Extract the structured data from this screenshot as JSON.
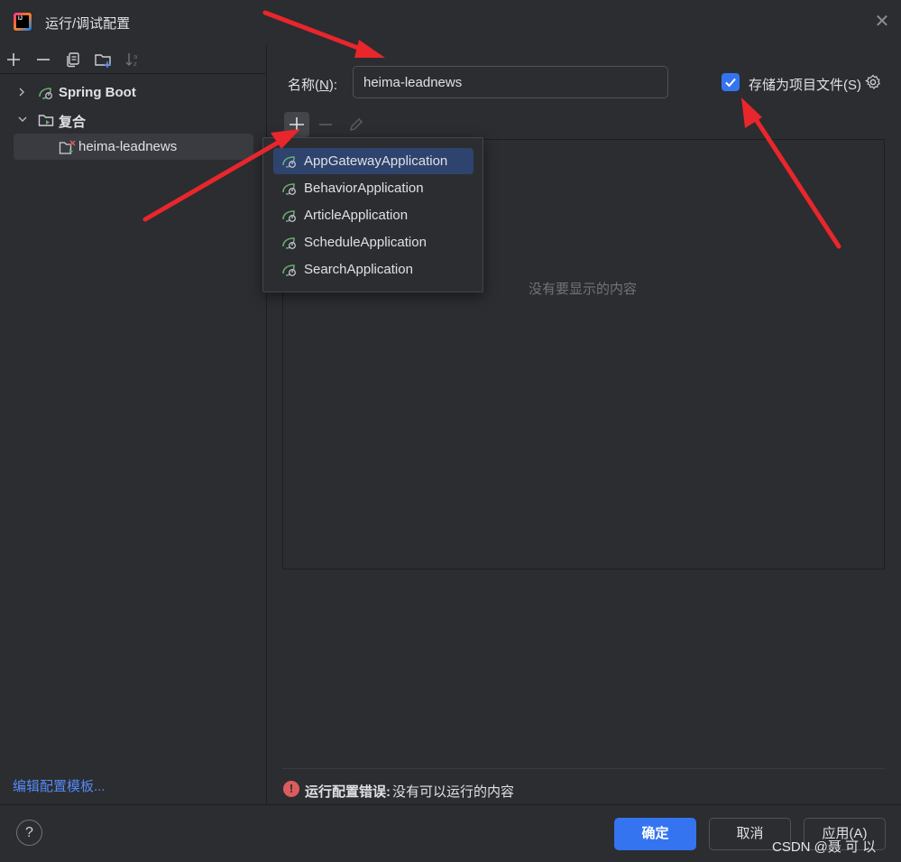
{
  "window": {
    "title": "运行/调试配置",
    "app_logo_text": "IJ"
  },
  "left_toolbar": {
    "icons": [
      "add-icon",
      "remove-icon",
      "copy-icon",
      "folder-add-icon",
      "sort-icon"
    ]
  },
  "tree": {
    "items": [
      {
        "label": "Spring Boot",
        "expanded": false,
        "icon": "spring-boot-icon"
      },
      {
        "label": "复合",
        "expanded": true,
        "icon": "folder-icon"
      },
      {
        "label": "heima-leadnews",
        "selected": true,
        "icon": "compound-config-icon"
      }
    ],
    "edit_templates_link": "编辑配置模板..."
  },
  "form": {
    "name_label": "名称(N):",
    "name_value": "heima-leadnews",
    "store_as_project_file_label": "存储为项目文件(S)",
    "store_as_project_file_checked": true
  },
  "list": {
    "empty_text": "没有要显示的内容"
  },
  "popup": {
    "items": [
      {
        "label": "AppGatewayApplication",
        "selected": true
      },
      {
        "label": "BehaviorApplication",
        "selected": false
      },
      {
        "label": "ArticleApplication",
        "selected": false
      },
      {
        "label": "ScheduleApplication",
        "selected": false
      },
      {
        "label": "SearchApplication",
        "selected": false
      }
    ]
  },
  "error": {
    "title": "运行配置错误:",
    "message": "没有可以运行的内容"
  },
  "footer": {
    "help": "?",
    "ok": "确定",
    "cancel": "取消",
    "apply": "应用(A)"
  },
  "watermark": "CSDN @聂 可 以",
  "colors": {
    "background": "#2b2d30",
    "accent": "#3574f0",
    "link": "#548af7",
    "error": "#db5c5c",
    "annotation_arrow": "#e8262c",
    "spring_green": "#6aab73"
  }
}
